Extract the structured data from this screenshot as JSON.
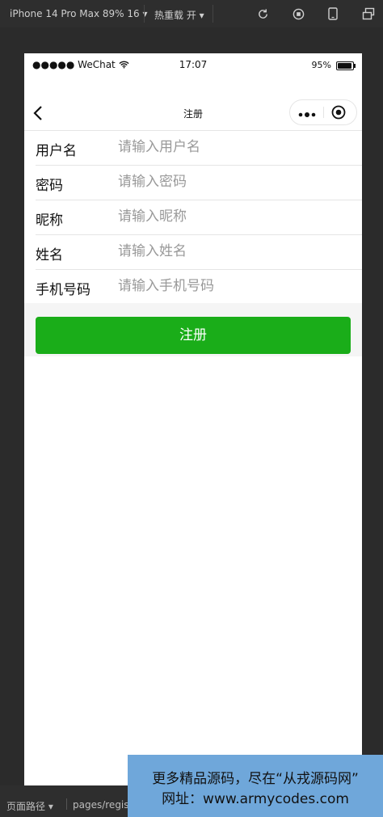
{
  "devtools": {
    "device_label": "iPhone 14 Pro Max 89% 16 ▾",
    "hot_reload_label": "热重载 开 ▾",
    "icons": [
      "refresh-icon",
      "stop-icon",
      "phone-icon",
      "window-icon"
    ],
    "bottom_path_label": "页面路径 ▾",
    "bottom_path_value": "pages/regis"
  },
  "statusbar": {
    "carrier": "●●●●● WeChat",
    "time": "17:07",
    "battery_pct": "95%",
    "battery_level": 0.95
  },
  "navbar": {
    "title": "注册"
  },
  "form": {
    "fields": [
      {
        "label": "用户名",
        "placeholder": "请输入用户名",
        "value": ""
      },
      {
        "label": "密码",
        "placeholder": "请输入密码",
        "value": ""
      },
      {
        "label": "昵称",
        "placeholder": "请输入昵称",
        "value": ""
      },
      {
        "label": "姓名",
        "placeholder": "请输入姓名",
        "value": ""
      },
      {
        "label": "手机号码",
        "placeholder": "请输入手机号码",
        "value": ""
      }
    ],
    "submit_label": "注册"
  },
  "watermark": {
    "line1": "更多精品源码，尽在“从戎源码网”",
    "line2": "网址：www.armycodes.com"
  },
  "colors": {
    "primary_button": "#1aad19",
    "watermark_bg": "#6fa7da"
  }
}
